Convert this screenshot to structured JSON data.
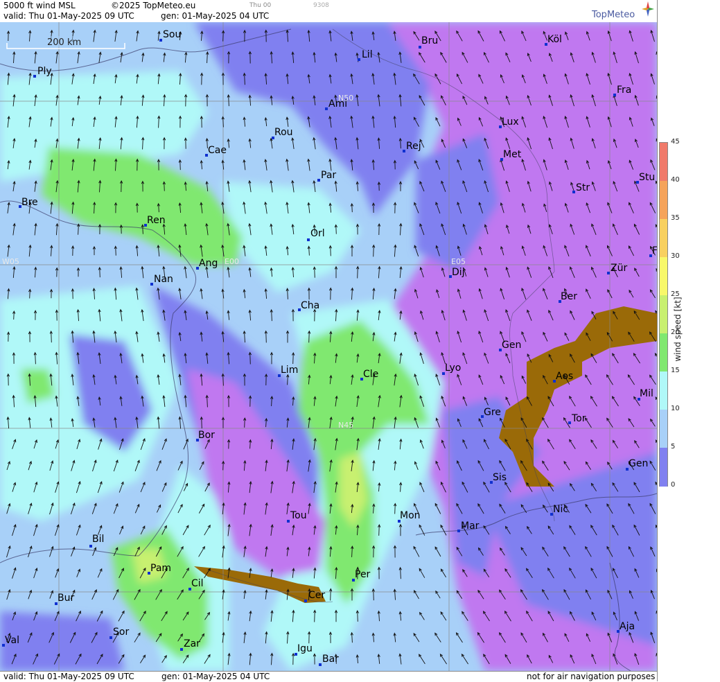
{
  "header": {
    "product": "5000 ft wind MSL",
    "copyright": "©2025 TopMeteo.eu",
    "day_tag": "Thu 00",
    "code": "9308",
    "valid": "valid:  Thu  01-May-2025  09 UTC",
    "generated": "gen: 01-May-2025 04 UTC",
    "logo": "TopMeteo"
  },
  "footer": {
    "valid": "valid:  Thu  01-May-2025  09 UTC",
    "generated": "gen: 01-May-2025 04 UTC",
    "disclaimer": "not for air navigation purposes"
  },
  "map": {
    "scale_label": "200 km",
    "grid_labels": [
      "N50",
      "N45",
      "W05",
      "E00",
      "E05"
    ],
    "cities": [
      "Sou",
      "Bru",
      "Köl",
      "Ply",
      "Lil",
      "Ami",
      "Fra",
      "Lux",
      "Rou",
      "Cae",
      "Rej",
      "Met",
      "Par",
      "Stu",
      "Bre",
      "Str",
      "Ren",
      "Orl",
      "F",
      "Ang",
      "Nan",
      "Dij",
      "Zür",
      "Cha",
      "Ber",
      "Gen",
      "Lim",
      "Cle",
      "Lyo",
      "Aos",
      "Mil",
      "Gre",
      "Tor",
      "Bor",
      "Gen",
      "Sis",
      "Nic",
      "Tou",
      "Mon",
      "Mar",
      "Bil",
      "Pam",
      "Cil",
      "Per",
      "Cer",
      "Bur",
      "Sor",
      "Zar",
      "Igu",
      "Bar",
      "Val",
      "Aja"
    ]
  },
  "colorbar": {
    "title": "wind speed [kt]",
    "ticks": [
      "45",
      "40",
      "35",
      "30",
      "25",
      "20",
      "15",
      "10",
      "5",
      "0"
    ],
    "colors": [
      "#f07a6a",
      "#f5a35a",
      "#f8d060",
      "#f8f86a",
      "#c8f070",
      "#80e870",
      "#b0f8f8",
      "#a8d0f8",
      "#8080f0",
      "#c078f0"
    ]
  }
}
